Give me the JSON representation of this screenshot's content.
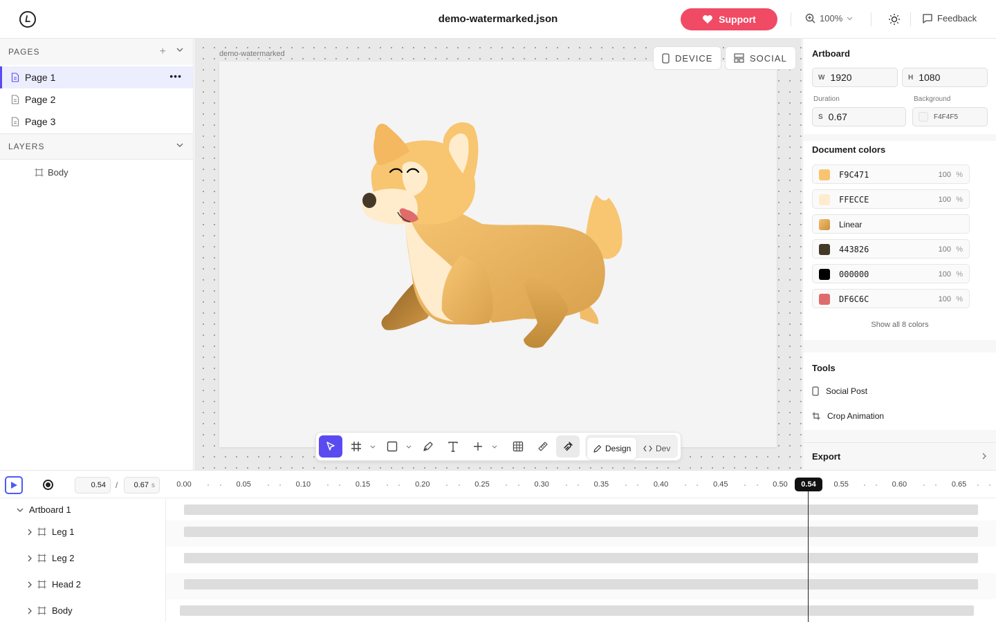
{
  "header": {
    "file_name": "demo-watermarked.json",
    "support_label": "Support",
    "zoom_label": "100%",
    "feedback_label": "Feedback"
  },
  "left_panel": {
    "pages_title": "PAGES",
    "pages": [
      {
        "label": "Page 1",
        "active": true
      },
      {
        "label": "Page 2",
        "active": false
      },
      {
        "label": "Page 3",
        "active": false
      }
    ],
    "more_label": "•••",
    "layers_title": "LAYERS",
    "layers": [
      {
        "label": "Body"
      }
    ]
  },
  "canvas": {
    "artboard_name": "demo-watermarked",
    "device_label": "DEVICE",
    "social_label": "SOCIAL",
    "colors": {
      "dog_main": "#F9C471",
      "dog_light": "#FFECCE",
      "dog_shadow": "#C79035",
      "nose": "#443826",
      "eyes": "#000000",
      "tongue": "#DF6C6C"
    }
  },
  "toolbar": {
    "tools": [
      "select-tool",
      "frame-tool",
      "shape-tool",
      "pen-tool",
      "text-tool",
      "add-tool",
      "grid-tool",
      "measure-tool",
      "snap-tool"
    ],
    "design_label": "Design",
    "dev_label": "Dev",
    "active_mode": "Design"
  },
  "right_panel": {
    "artboard_title": "Artboard",
    "width_prefix": "W",
    "width_value": "1920",
    "height_prefix": "H",
    "height_value": "1080",
    "duration_label": "Duration",
    "duration_prefix": "S",
    "duration_value": "0.67",
    "background_label": "Background",
    "background_value": "F4F4F5",
    "doc_colors_title": "Document colors",
    "doc_colors": [
      {
        "swatch": "#F9C471",
        "label": "F9C471",
        "opacity": "100",
        "unit": "%"
      },
      {
        "swatch": "#FFECCE",
        "label": "FFECCE",
        "opacity": "100",
        "unit": "%"
      },
      {
        "swatch": "#D9A14A",
        "label": "Linear",
        "opacity": "",
        "unit": ""
      },
      {
        "swatch": "#443826",
        "label": "443826",
        "opacity": "100",
        "unit": "%"
      },
      {
        "swatch": "#000000",
        "label": "000000",
        "opacity": "100",
        "unit": "%"
      },
      {
        "swatch": "#DF6C6C",
        "label": "DF6C6C",
        "opacity": "100",
        "unit": "%"
      }
    ],
    "show_all_label": "Show all 8 colors",
    "tools_title": "Tools",
    "tools": [
      {
        "icon": "phone-icon",
        "label": "Social Post"
      },
      {
        "icon": "crop-icon",
        "label": "Crop Animation"
      }
    ],
    "export_label": "Export"
  },
  "timeline": {
    "current_time": "0.54",
    "separator": "/",
    "total_time": "0.67",
    "unit": "s",
    "ruler_labels": [
      "0.00",
      "0.05",
      "0.10",
      "0.15",
      "0.20",
      "0.25",
      "0.30",
      "0.35",
      "0.40",
      "0.45",
      "0.50",
      "0.55",
      "0.60",
      "0.65"
    ],
    "playhead_label": "0.54",
    "tracks": [
      {
        "label": "Artboard 1",
        "expanded": true
      },
      {
        "label": "Leg 1"
      },
      {
        "label": "Leg 2"
      },
      {
        "label": "Head 2"
      },
      {
        "label": "Body"
      }
    ]
  }
}
